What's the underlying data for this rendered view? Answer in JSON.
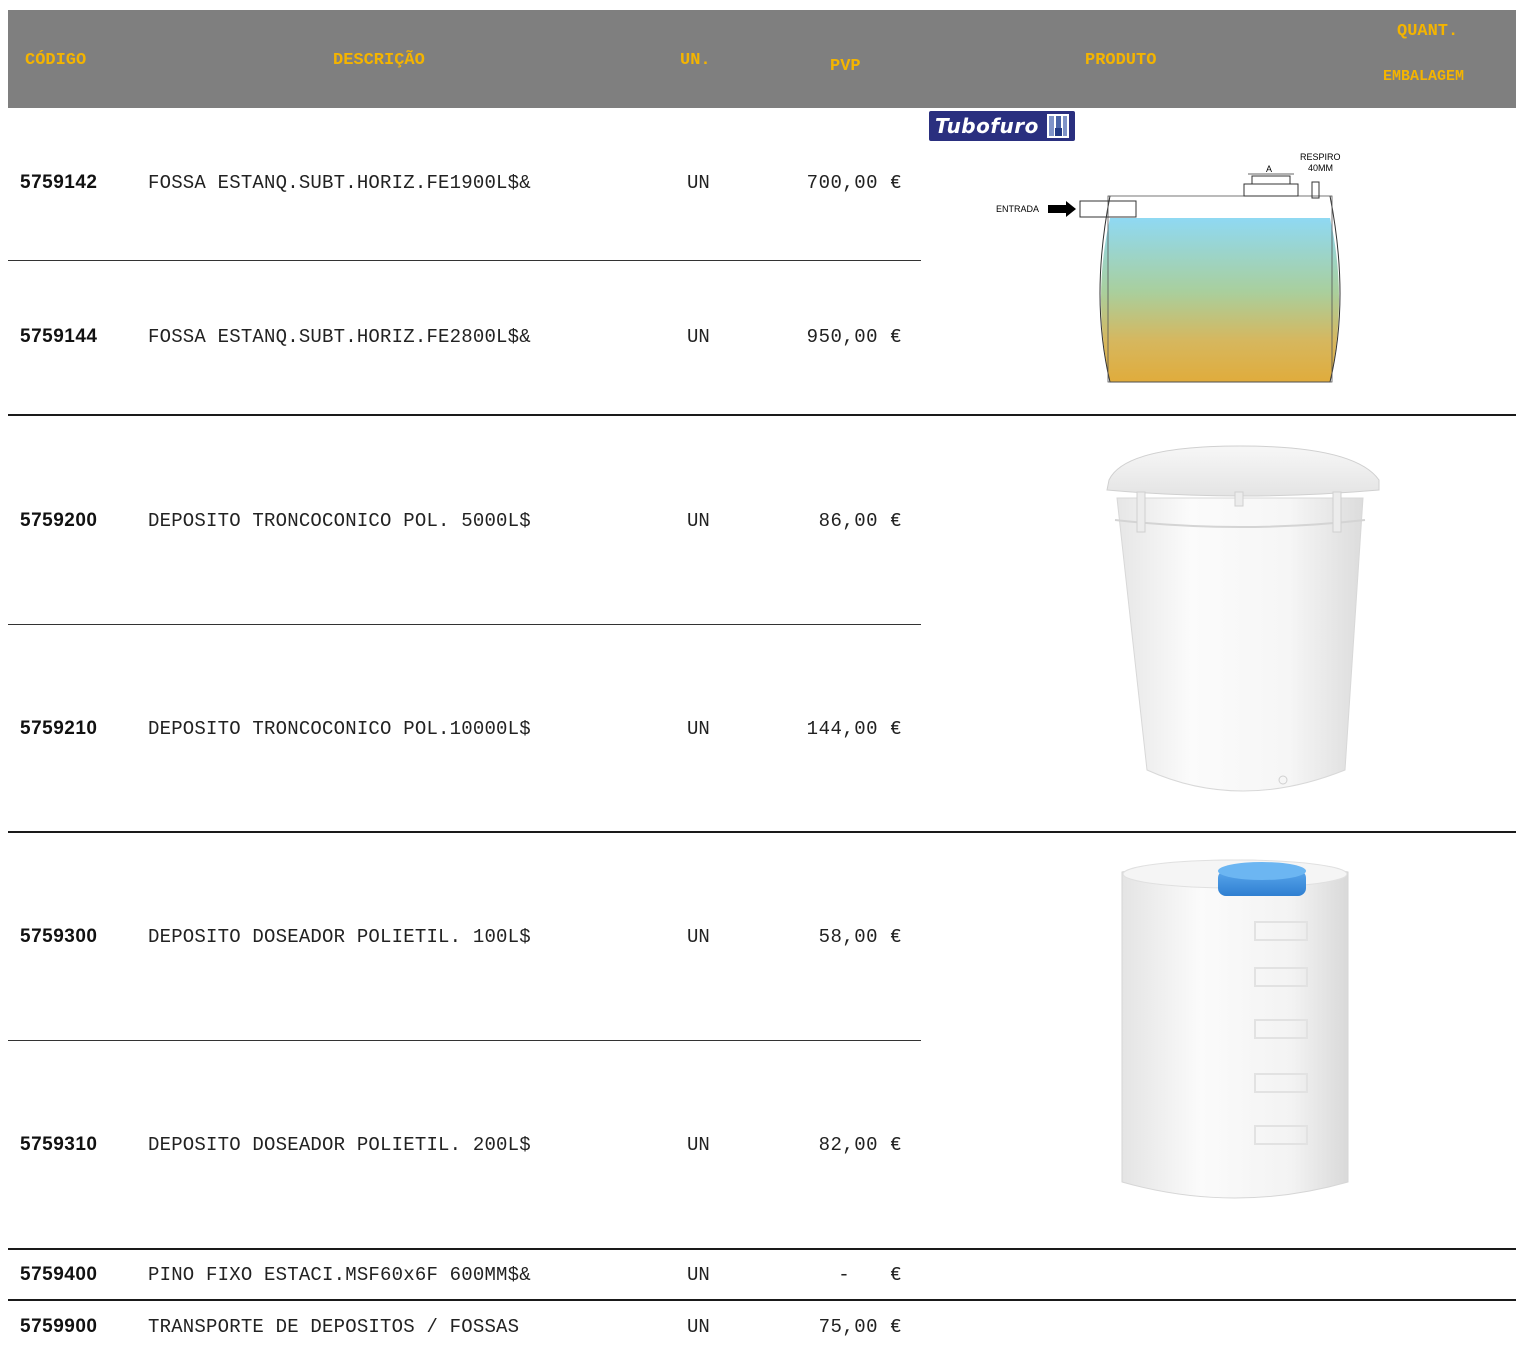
{
  "header": {
    "codigo": "CÓDIGO",
    "descricao": "DESCRIÇÃO",
    "un": "UN.",
    "pvp": "PVP",
    "produto": "PRODUTO",
    "quant": "QUANT.",
    "embalagem": "EMBALAGEM"
  },
  "rows": [
    {
      "code": "5759142",
      "desc": "FOSSA ESTANQ.SUBT.HORIZ.FE1900L$&",
      "unit": "UN",
      "price": "700,00",
      "currency": "€"
    },
    {
      "code": "5759144",
      "desc": "FOSSA ESTANQ.SUBT.HORIZ.FE2800L$&",
      "unit": "UN",
      "price": "950,00",
      "currency": "€"
    },
    {
      "code": "5759200",
      "desc": "DEPOSITO TRONCOCONICO POL. 5000L$",
      "unit": "UN",
      "price": "86,00",
      "currency": "€"
    },
    {
      "code": "5759210",
      "desc": "DEPOSITO TRONCOCONICO POL.10000L$",
      "unit": "UN",
      "price": "144,00",
      "currency": "€"
    },
    {
      "code": "5759300",
      "desc": "DEPOSITO DOSEADOR POLIETIL. 100L$",
      "unit": "UN",
      "price": "58,00",
      "currency": "€"
    },
    {
      "code": "5759310",
      "desc": "DEPOSITO DOSEADOR POLIETIL. 200L$",
      "unit": "UN",
      "price": "82,00",
      "currency": "€"
    },
    {
      "code": "5759400",
      "desc": "PINO FIXO ESTACI.MSF60x6F 600MM$&",
      "unit": "UN",
      "price": "-",
      "currency": "€"
    },
    {
      "code": "5759900",
      "desc": "TRANSPORTE DE DEPOSITOS / FOSSAS",
      "unit": "UN",
      "price": "75,00",
      "currency": "€"
    }
  ],
  "logo": {
    "text": "Tubofuro"
  },
  "diagram": {
    "entrada": "ENTRADA",
    "a": "A",
    "respiro": "RESPIRO",
    "respiro_size": "40MM"
  }
}
